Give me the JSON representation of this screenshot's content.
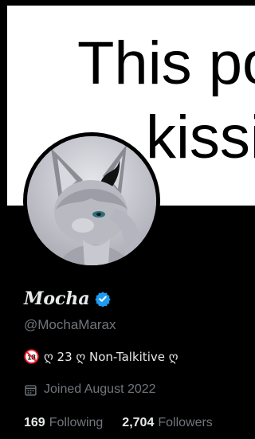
{
  "banner": {
    "line1": "This po",
    "line2": "kissi"
  },
  "profile": {
    "display_name": "Mocha",
    "handle": "@MochaMarax",
    "verified": true,
    "bio": {
      "age_badge": "18",
      "text": "ღ 23 ღ Non-Talkitive ღ"
    },
    "joined": "Joined August 2022"
  },
  "stats": {
    "following_count": "169",
    "following_label": "Following",
    "followers_count": "2,704",
    "followers_label": "Followers"
  },
  "colors": {
    "background": "#000000",
    "primary_text": "#e7e9ea",
    "secondary_text": "#71767b",
    "verified": "#1d9bf0",
    "age_badge": "#f4212e"
  },
  "icons": {
    "verified": "verified-badge-icon",
    "age": "no-under-18-icon",
    "calendar": "calendar-icon"
  }
}
